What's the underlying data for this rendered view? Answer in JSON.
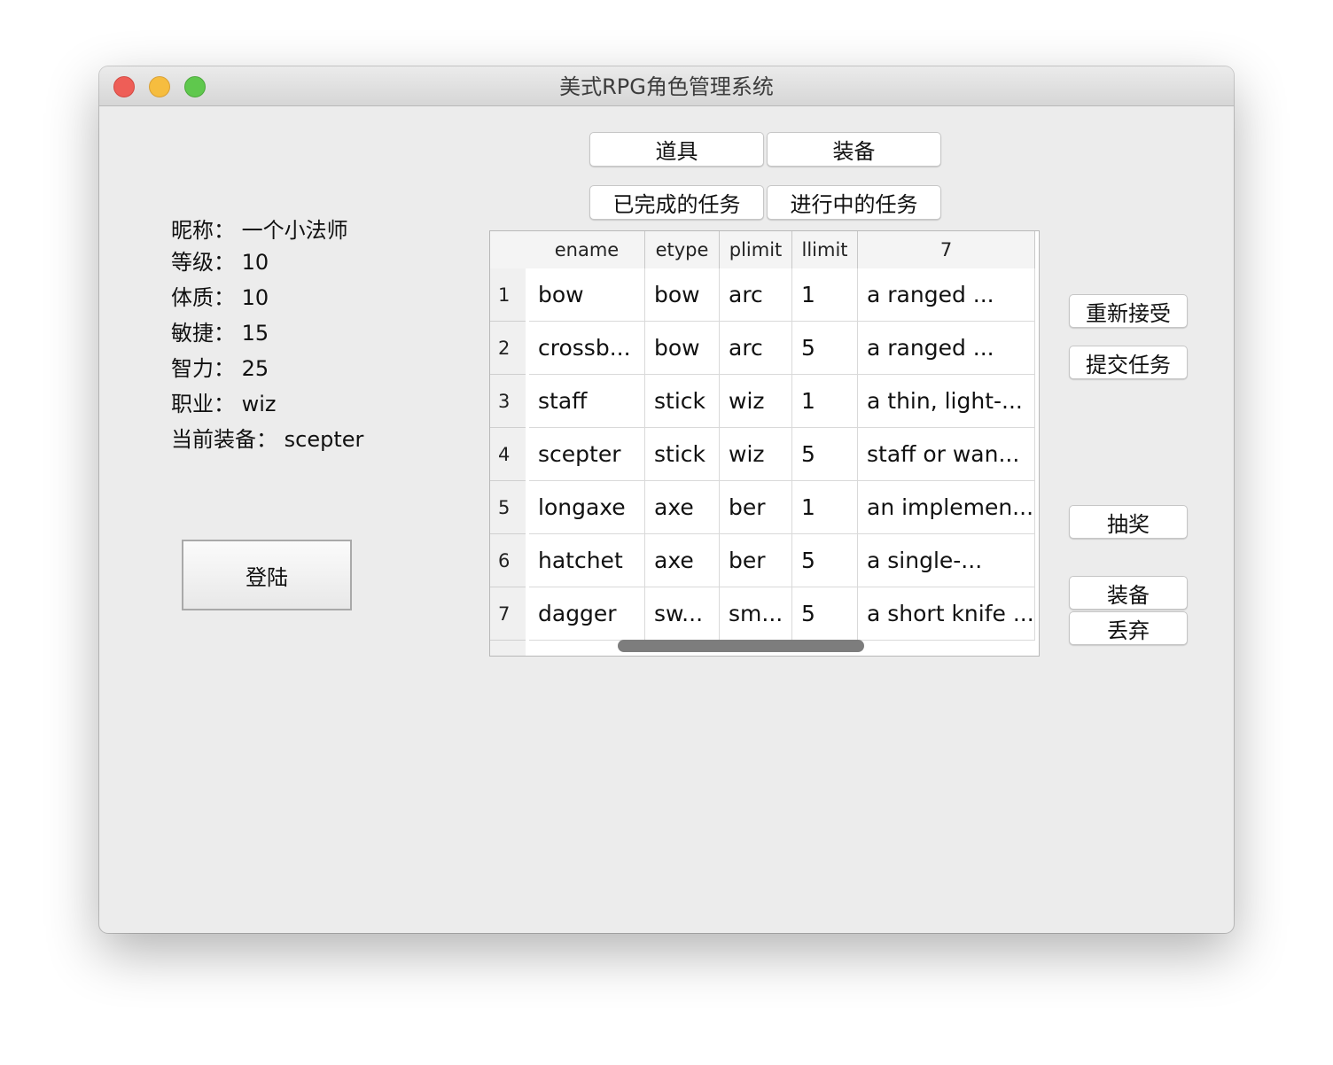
{
  "window": {
    "title": "美式RPG角色管理系统"
  },
  "profile": {
    "nickname": "昵称：  一个小法师",
    "level": "等级：  10",
    "constitution": "体质：  10",
    "agility": "敏捷：  15",
    "intelligence": "智力：  25",
    "profession": "职业：  wiz",
    "current_equipment": "当前装备：  scepter"
  },
  "login_label": "登陆",
  "tabs": {
    "items": "道具",
    "equipment": "装备",
    "completed_tasks": "已完成的任务",
    "ongoing_tasks": "进行中的任务"
  },
  "side_buttons": {
    "reaccept": "重新接受",
    "submit_task": "提交任务",
    "lottery": "抽奖",
    "equip": "装备",
    "discard": "丢弃"
  },
  "table": {
    "columns": [
      "ename",
      "etype",
      "plimit",
      "llimit",
      "7"
    ],
    "rows": [
      {
        "num": "1",
        "cells": [
          "bow",
          "bow",
          "arc",
          "1",
          "a ranged ..."
        ]
      },
      {
        "num": "2",
        "cells": [
          "crossb...",
          "bow",
          "arc",
          "5",
          "a ranged ..."
        ]
      },
      {
        "num": "3",
        "cells": [
          "staff",
          "stick",
          "wiz",
          "1",
          "a thin, light-..."
        ]
      },
      {
        "num": "4",
        "cells": [
          "scepter",
          "stick",
          "wiz",
          "5",
          " staff or wan..."
        ]
      },
      {
        "num": "5",
        "cells": [
          "longaxe",
          "axe",
          "ber",
          "1",
          "an implemen..."
        ]
      },
      {
        "num": "6",
        "cells": [
          "hatchet",
          "axe",
          "ber",
          "5",
          "a single-..."
        ]
      },
      {
        "num": "7",
        "cells": [
          "dagger",
          "sw...",
          "sm...",
          "5",
          "a short knife ..."
        ]
      }
    ]
  }
}
